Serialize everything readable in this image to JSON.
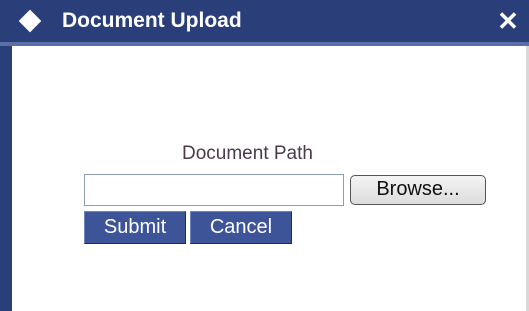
{
  "window": {
    "title": "Document Upload",
    "close_glyph": "✕",
    "title_icon": "diamond-icon",
    "close_icon": "close-icon"
  },
  "form": {
    "label": "Document Path",
    "path_value": "",
    "browse_label": "Browse...",
    "submit_label": "Submit",
    "cancel_label": "Cancel"
  },
  "colors": {
    "titlebar": "#2a3f7a",
    "button": "#3d5499",
    "label_text": "#4a3a4a"
  }
}
